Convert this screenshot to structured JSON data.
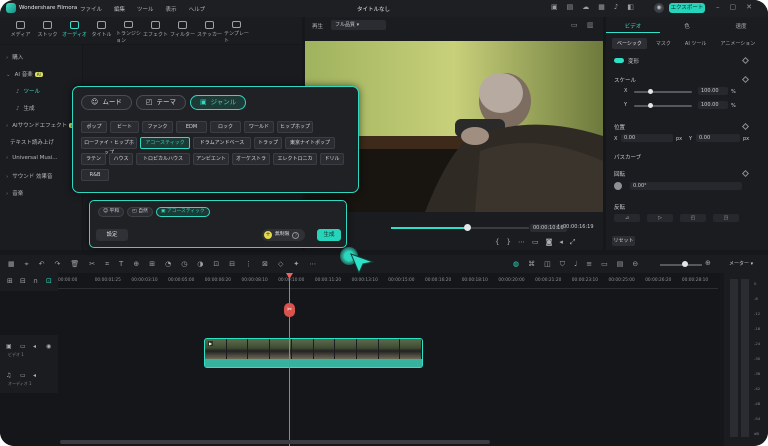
{
  "titlebar": {
    "app_name": "Wondershare Filmora",
    "menus": [
      "ファイル",
      "編集",
      "ツール",
      "表示",
      "ヘルプ"
    ],
    "doc_title": "タイトルなし",
    "export_label": "エクスポート ▾",
    "avatar": "◉"
  },
  "library_tabs": [
    {
      "label": "メディア",
      "icon": "media-icon"
    },
    {
      "label": "ストック",
      "icon": "stock-icon"
    },
    {
      "label": "オーディオ",
      "icon": "audio-icon"
    },
    {
      "label": "タイトル",
      "icon": "title-icon"
    },
    {
      "label": "トランジション",
      "icon": "transition-icon"
    },
    {
      "label": "エフェクト",
      "icon": "effect-icon"
    },
    {
      "label": "フィルター",
      "icon": "filter-icon"
    },
    {
      "label": "ステッカー",
      "icon": "sticker-icon"
    },
    {
      "label": "テンプレート",
      "icon": "template-icon"
    }
  ],
  "sidebar": {
    "items": [
      {
        "label": "購入",
        "expandable": true
      },
      {
        "label": "AI 音楽",
        "badge": "AI",
        "expandable": true
      },
      {
        "label": "ツール",
        "selected": true
      },
      {
        "label": "生成"
      },
      {
        "label": "AIサウンドエフェクト",
        "badge": "AI",
        "expandable": true
      },
      {
        "label": "テキスト読み上げ",
        "expandable": false
      },
      {
        "label": "Universal Musi...",
        "expandable": true
      },
      {
        "label": "サウンド 効果音",
        "expandable": true
      },
      {
        "label": "音楽",
        "expandable": true
      }
    ]
  },
  "preview": {
    "label": "再生",
    "quality": "フル品質 ▾",
    "current_time": "00:00:10:16",
    "separator": "/",
    "total_time": "00:00:16:19",
    "progress": 0.55
  },
  "properties": {
    "tabs": [
      "ビデオ",
      "色",
      "速度"
    ],
    "subtabs": [
      "ベーシック",
      "マスク",
      "AI ツール",
      "アニメーション"
    ],
    "transform_label": "変形",
    "scale_label": "スケール",
    "scale_x": "100.00",
    "scale_y": "100.00",
    "percent": "%",
    "position_label": "位置",
    "pos_x_label": "X",
    "pos_x": "0.00",
    "pos_y_label": "Y",
    "pos_y": "0.00",
    "px": "px",
    "path_curve_label": "パスカーブ",
    "rotate_label": "回転",
    "rotate_value": "0.00°",
    "flip_label": "反転",
    "reset_label": "リセット"
  },
  "ai_music_panel": {
    "segments": [
      {
        "label": "ムード",
        "icon": "mood-icon"
      },
      {
        "label": "テーマ",
        "icon": "theme-icon"
      },
      {
        "label": "ジャンル",
        "icon": "genre-icon",
        "active": true
      }
    ],
    "genres": [
      {
        "label": "ポップ"
      },
      {
        "label": "ビート"
      },
      {
        "label": "ファンク"
      },
      {
        "label": "EDM"
      },
      {
        "label": "ロック"
      },
      {
        "label": "ワールド"
      },
      {
        "label": "ヒップホップ"
      },
      {
        "label": "ローファイ・ヒップホップ"
      },
      {
        "label": "アコースティック",
        "active": true
      },
      {
        "label": "ドラムアンドベース"
      },
      {
        "label": "トラップ"
      },
      {
        "label": "東京ナイトポップ"
      },
      {
        "label": "ラテン"
      },
      {
        "label": "ハウス"
      },
      {
        "label": "トロピカルハウス"
      },
      {
        "label": "アンビエント"
      },
      {
        "label": "オーケストラ"
      },
      {
        "label": "エレクトロニカ"
      },
      {
        "label": "ドリル"
      },
      {
        "label": "R&B"
      }
    ]
  },
  "generate_panel": {
    "tags": [
      {
        "label": "平和",
        "icon": "mood-icon"
      },
      {
        "label": "自然",
        "icon": "theme-icon"
      },
      {
        "label": "アコースティック",
        "icon": "genre-icon",
        "active": true
      }
    ],
    "settings_label": "設定",
    "credits_label": "無制限",
    "generate_label": "生成"
  },
  "timeline": {
    "ruler_ticks": [
      "00:00:00",
      "00:00:01:25",
      "00:00:03:10",
      "00:00:05:00",
      "00:00:06:20",
      "00:00:08:10",
      "00:00:10:00",
      "00:00:11:20",
      "00:00:13:10",
      "00:00:15:00",
      "00:00:16:20",
      "00:00:18:10",
      "00:00:20:00",
      "00:00:21:20",
      "00:00:23:10",
      "00:00:25:00",
      "00:00:26:20",
      "00:00:28:10"
    ],
    "tracks": [
      {
        "name": "ビデオ 1"
      },
      {
        "name": "オーディオ 1"
      }
    ],
    "clip_label": "▶"
  },
  "meter": {
    "title": "メーター ▾",
    "scale": [
      "0",
      "-6",
      "-12",
      "-18",
      "-24",
      "-30",
      "-36",
      "-42",
      "-48",
      "-54",
      "dB"
    ]
  }
}
